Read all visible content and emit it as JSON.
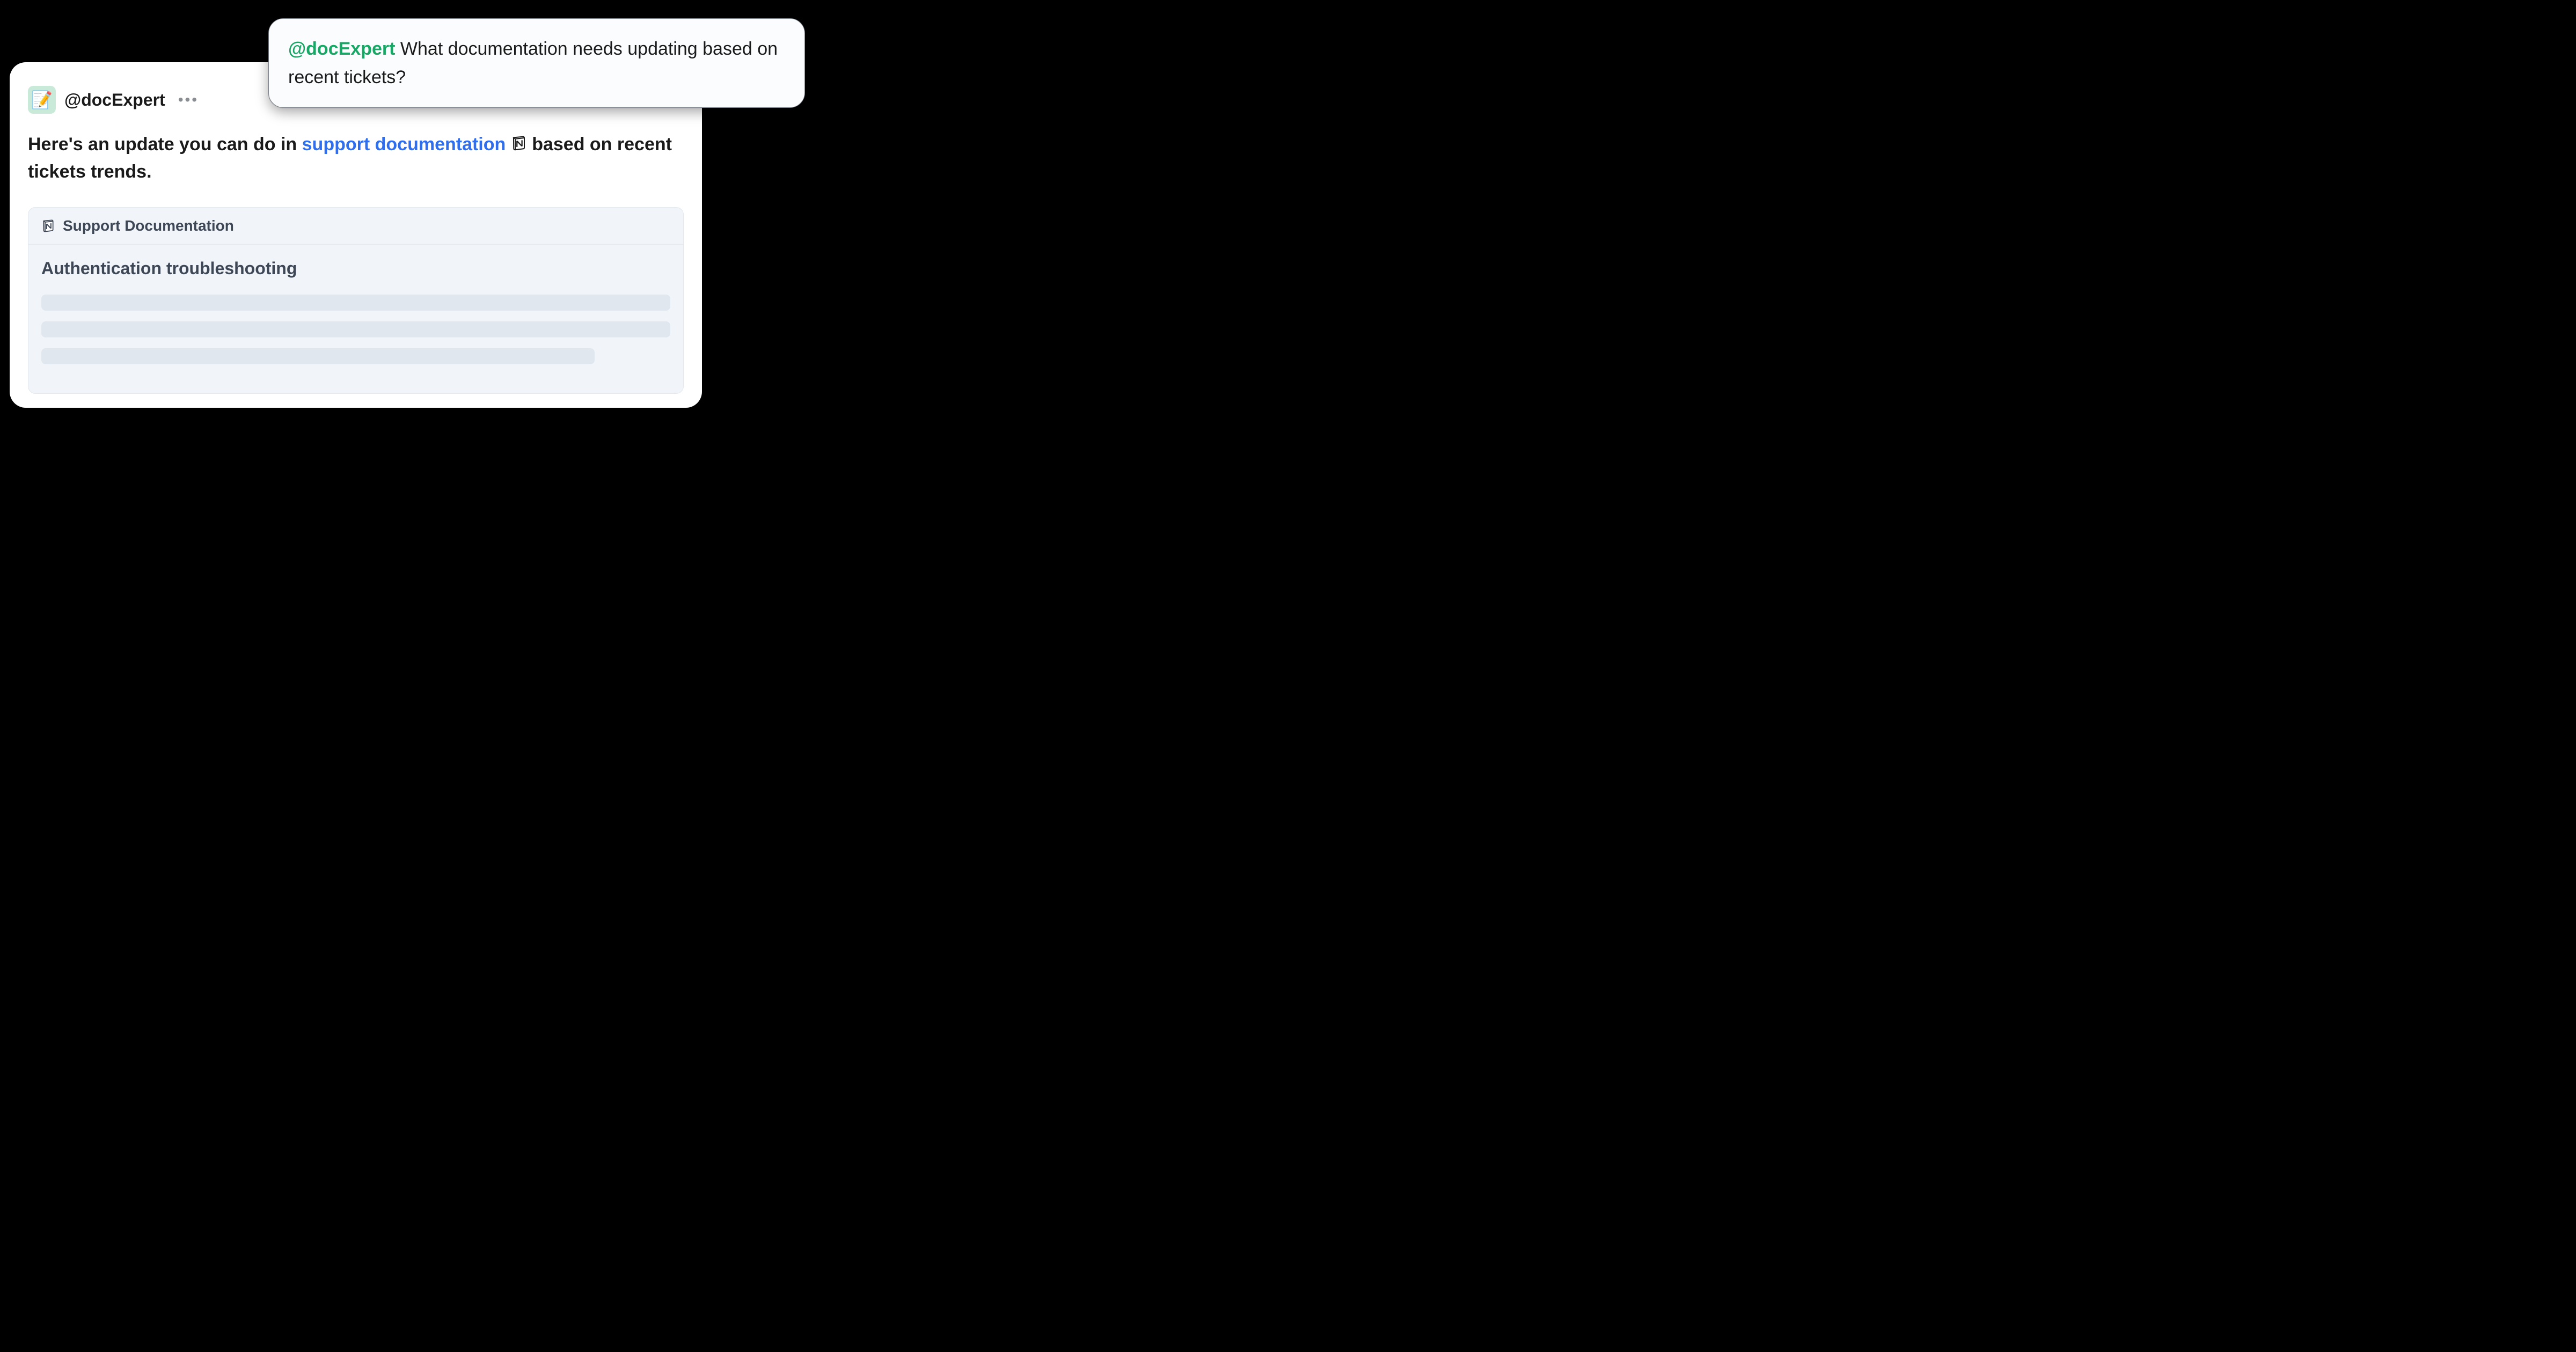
{
  "query": {
    "mention": "@docExpert",
    "text": "What documentation needs updating based on recent tickets?"
  },
  "response": {
    "bot_name": "@docExpert",
    "avatar_emoji": "📝",
    "more_icon_label": "more-options",
    "text_before_link": "Here's an update you can do in ",
    "link_text": "support documentation",
    "text_after_link": " based on recent tickets trends.",
    "notion_icon_label": "notion-icon"
  },
  "doc_card": {
    "title": "Support Documentation",
    "heading": "Authentication troubleshooting"
  }
}
